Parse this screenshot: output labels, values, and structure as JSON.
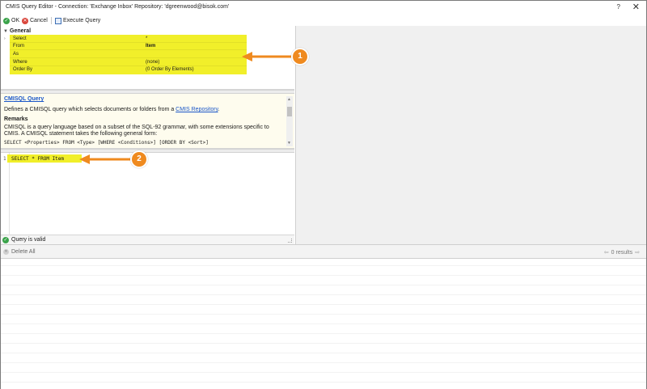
{
  "window": {
    "title": "CMIS Query Editor - Connection: 'Exchange Inbox' Repository: 'dgreenwood@bisok.com'",
    "help_label": "?",
    "close_label": "✕"
  },
  "toolbar": {
    "ok_label": "OK",
    "cancel_label": "Cancel",
    "execute_label": "Execute Query"
  },
  "properties": {
    "category": "General",
    "rows": [
      {
        "name": "Select",
        "value": "*"
      },
      {
        "name": "From",
        "value": "Item"
      },
      {
        "name": "As",
        "value": ""
      },
      {
        "name": "Where",
        "value": "(none)"
      },
      {
        "name": "Order By",
        "value": "(0 Order By Elements)"
      }
    ]
  },
  "help": {
    "title": "CMISQL Query",
    "description_prefix": "Defines a CMISQL query which selects documents or folders from a ",
    "description_link": "CMIS Repository",
    "description_suffix": ".",
    "remarks_heading": "Remarks",
    "remarks_text": "CMISQL is a query language based on a subset of the SQL-92 grammar, with some extensions specific to CMIS. A CMISQL statement takes the following general form:",
    "syntax": "SELECT <Properties> FROM <Type> [WHERE <Conditions>] [ORDER BY <Sort>]"
  },
  "editor": {
    "line_number": "1",
    "code": "SELECT * FROM Item"
  },
  "status": {
    "text": "Query is valid"
  },
  "results": {
    "delete_all_label": "Delete All",
    "count_text": "0 results"
  },
  "callouts": [
    {
      "label": "1"
    },
    {
      "label": "2"
    }
  ],
  "colors": {
    "highlight": "#f1ef2a",
    "callout": "#ef8a1f",
    "link": "#1a56c8",
    "valid": "#3aa34a"
  }
}
